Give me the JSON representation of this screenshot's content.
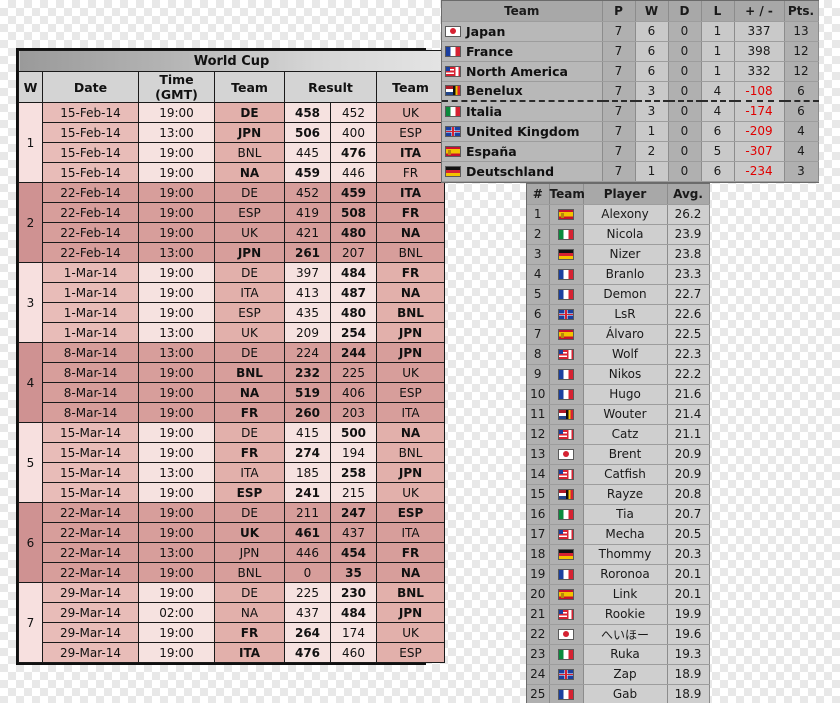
{
  "world_cup": {
    "title": "World Cup",
    "headers": [
      "W",
      "Date",
      "Time (GMT)",
      "Team",
      "Result",
      "Team"
    ],
    "weeks": [
      {
        "w": "1",
        "tint": "odd",
        "matches": [
          {
            "date": "15-Feb-14",
            "time": "19:00",
            "home": "DE",
            "hs": "458",
            "as": "452",
            "away": "UK",
            "winner": "home"
          },
          {
            "date": "15-Feb-14",
            "time": "13:00",
            "home": "JPN",
            "hs": "506",
            "as": "400",
            "away": "ESP",
            "winner": "home"
          },
          {
            "date": "15-Feb-14",
            "time": "19:00",
            "home": "BNL",
            "hs": "445",
            "as": "476",
            "away": "ITA",
            "winner": "away"
          },
          {
            "date": "15-Feb-14",
            "time": "19:00",
            "home": "NA",
            "hs": "459",
            "as": "446",
            "away": "FR",
            "winner": "home"
          }
        ]
      },
      {
        "w": "2",
        "tint": "even",
        "matches": [
          {
            "date": "22-Feb-14",
            "time": "19:00",
            "home": "DE",
            "hs": "452",
            "as": "459",
            "away": "ITA",
            "winner": "away"
          },
          {
            "date": "22-Feb-14",
            "time": "19:00",
            "home": "ESP",
            "hs": "419",
            "as": "508",
            "away": "FR",
            "winner": "away"
          },
          {
            "date": "22-Feb-14",
            "time": "19:00",
            "home": "UK",
            "hs": "421",
            "as": "480",
            "away": "NA",
            "winner": "away"
          },
          {
            "date": "22-Feb-14",
            "time": "13:00",
            "home": "JPN",
            "hs": "261",
            "as": "207",
            "away": "BNL",
            "winner": "home"
          }
        ]
      },
      {
        "w": "3",
        "tint": "odd",
        "matches": [
          {
            "date": "1-Mar-14",
            "time": "19:00",
            "home": "DE",
            "hs": "397",
            "as": "484",
            "away": "FR",
            "winner": "away"
          },
          {
            "date": "1-Mar-14",
            "time": "19:00",
            "home": "ITA",
            "hs": "413",
            "as": "487",
            "away": "NA",
            "winner": "away"
          },
          {
            "date": "1-Mar-14",
            "time": "19:00",
            "home": "ESP",
            "hs": "435",
            "as": "480",
            "away": "BNL",
            "winner": "away"
          },
          {
            "date": "1-Mar-14",
            "time": "13:00",
            "home": "UK",
            "hs": "209",
            "as": "254",
            "away": "JPN",
            "winner": "away"
          }
        ]
      },
      {
        "w": "4",
        "tint": "even",
        "matches": [
          {
            "date": "8-Mar-14",
            "time": "13:00",
            "home": "DE",
            "hs": "224",
            "as": "244",
            "away": "JPN",
            "winner": "away"
          },
          {
            "date": "8-Mar-14",
            "time": "19:00",
            "home": "BNL",
            "hs": "232",
            "as": "225",
            "away": "UK",
            "winner": "home"
          },
          {
            "date": "8-Mar-14",
            "time": "19:00",
            "home": "NA",
            "hs": "519",
            "as": "406",
            "away": "ESP",
            "winner": "home"
          },
          {
            "date": "8-Mar-14",
            "time": "19:00",
            "home": "FR",
            "hs": "260",
            "as": "203",
            "away": "ITA",
            "winner": "home"
          }
        ]
      },
      {
        "w": "5",
        "tint": "odd",
        "matches": [
          {
            "date": "15-Mar-14",
            "time": "19:00",
            "home": "DE",
            "hs": "415",
            "as": "500",
            "away": "NA",
            "winner": "away"
          },
          {
            "date": "15-Mar-14",
            "time": "19:00",
            "home": "FR",
            "hs": "274",
            "as": "194",
            "away": "BNL",
            "winner": "home"
          },
          {
            "date": "15-Mar-14",
            "time": "13:00",
            "home": "ITA",
            "hs": "185",
            "as": "258",
            "away": "JPN",
            "winner": "away"
          },
          {
            "date": "15-Mar-14",
            "time": "19:00",
            "home": "ESP",
            "hs": "241",
            "as": "215",
            "away": "UK",
            "winner": "home"
          }
        ]
      },
      {
        "w": "6",
        "tint": "even",
        "matches": [
          {
            "date": "22-Mar-14",
            "time": "19:00",
            "home": "DE",
            "hs": "211",
            "as": "247",
            "away": "ESP",
            "winner": "away"
          },
          {
            "date": "22-Mar-14",
            "time": "19:00",
            "home": "UK",
            "hs": "461",
            "as": "437",
            "away": "ITA",
            "winner": "home"
          },
          {
            "date": "22-Mar-14",
            "time": "13:00",
            "home": "JPN",
            "hs": "446",
            "as": "454",
            "away": "FR",
            "winner": "away"
          },
          {
            "date": "22-Mar-14",
            "time": "19:00",
            "home": "BNL",
            "hs": "0",
            "as": "35",
            "away": "NA",
            "winner": "away"
          }
        ]
      },
      {
        "w": "7",
        "tint": "odd",
        "matches": [
          {
            "date": "29-Mar-14",
            "time": "19:00",
            "home": "DE",
            "hs": "225",
            "as": "230",
            "away": "BNL",
            "winner": "away"
          },
          {
            "date": "29-Mar-14",
            "time": "02:00",
            "home": "NA",
            "hs": "437",
            "as": "484",
            "away": "JPN",
            "winner": "away"
          },
          {
            "date": "29-Mar-14",
            "time": "19:00",
            "home": "FR",
            "hs": "264",
            "as": "174",
            "away": "UK",
            "winner": "home"
          },
          {
            "date": "29-Mar-14",
            "time": "19:00",
            "home": "ITA",
            "hs": "476",
            "as": "460",
            "away": "ESP",
            "winner": "home"
          }
        ]
      }
    ]
  },
  "standings": {
    "headers": [
      "Team",
      "P",
      "W",
      "D",
      "L",
      "+ / -",
      "Pts."
    ],
    "rows": [
      {
        "flag": "jp",
        "team": "Japan",
        "p": "7",
        "w": "6",
        "d": "0",
        "l": "1",
        "diff": "337",
        "pts": "13",
        "neg": false
      },
      {
        "flag": "fr",
        "team": "France",
        "p": "7",
        "w": "6",
        "d": "0",
        "l": "1",
        "diff": "398",
        "pts": "12",
        "neg": false
      },
      {
        "flag": "na",
        "team": "North America",
        "p": "7",
        "w": "6",
        "d": "0",
        "l": "1",
        "diff": "332",
        "pts": "12",
        "neg": false
      },
      {
        "flag": "bnl",
        "team": "Benelux",
        "p": "7",
        "w": "3",
        "d": "0",
        "l": "4",
        "diff": "-108",
        "pts": "6",
        "neg": true
      },
      {
        "flag": "it",
        "team": "Italia",
        "p": "7",
        "w": "3",
        "d": "0",
        "l": "4",
        "diff": "-174",
        "pts": "6",
        "neg": true
      },
      {
        "flag": "uk",
        "team": "United Kingdom",
        "p": "7",
        "w": "1",
        "d": "0",
        "l": "6",
        "diff": "-209",
        "pts": "4",
        "neg": true
      },
      {
        "flag": "es",
        "team": "España",
        "p": "7",
        "w": "2",
        "d": "0",
        "l": "5",
        "diff": "-307",
        "pts": "4",
        "neg": true
      },
      {
        "flag": "de",
        "team": "Deutschland",
        "p": "7",
        "w": "1",
        "d": "0",
        "l": "6",
        "diff": "-234",
        "pts": "3",
        "neg": true
      }
    ],
    "cut_after_index": 3
  },
  "players": {
    "headers": [
      "#",
      "Team",
      "Player",
      "Avg."
    ],
    "rows": [
      {
        "rank": "1",
        "flag": "es",
        "player": "Alexony",
        "avg": "26.2"
      },
      {
        "rank": "2",
        "flag": "it",
        "player": "Nicola",
        "avg": "23.9"
      },
      {
        "rank": "3",
        "flag": "de",
        "player": "Nizer",
        "avg": "23.8"
      },
      {
        "rank": "4",
        "flag": "fr",
        "player": "Branlo",
        "avg": "23.3"
      },
      {
        "rank": "5",
        "flag": "fr",
        "player": "Demon",
        "avg": "22.7"
      },
      {
        "rank": "6",
        "flag": "uk",
        "player": "LsR",
        "avg": "22.6"
      },
      {
        "rank": "7",
        "flag": "es",
        "player": "Álvaro",
        "avg": "22.5"
      },
      {
        "rank": "8",
        "flag": "na",
        "player": "Wolf",
        "avg": "22.3"
      },
      {
        "rank": "9",
        "flag": "fr",
        "player": "Nikos",
        "avg": "22.2"
      },
      {
        "rank": "10",
        "flag": "fr",
        "player": "Hugo",
        "avg": "21.6"
      },
      {
        "rank": "11",
        "flag": "bnl",
        "player": "Wouter",
        "avg": "21.4"
      },
      {
        "rank": "12",
        "flag": "na",
        "player": "Catz",
        "avg": "21.1"
      },
      {
        "rank": "13",
        "flag": "jp",
        "player": "Brent",
        "avg": "20.9"
      },
      {
        "rank": "14",
        "flag": "na",
        "player": "Catfish",
        "avg": "20.9"
      },
      {
        "rank": "15",
        "flag": "bnl",
        "player": "Rayze",
        "avg": "20.8"
      },
      {
        "rank": "16",
        "flag": "it",
        "player": "Tia",
        "avg": "20.7"
      },
      {
        "rank": "17",
        "flag": "na",
        "player": "Mecha",
        "avg": "20.5"
      },
      {
        "rank": "18",
        "flag": "de",
        "player": "Thommy",
        "avg": "20.3"
      },
      {
        "rank": "19",
        "flag": "fr",
        "player": "Roronoa",
        "avg": "20.1"
      },
      {
        "rank": "20",
        "flag": "es",
        "player": "Link",
        "avg": "20.1"
      },
      {
        "rank": "21",
        "flag": "na",
        "player": "Rookie",
        "avg": "19.9"
      },
      {
        "rank": "22",
        "flag": "jp",
        "player": "へいほー",
        "avg": "19.6"
      },
      {
        "rank": "23",
        "flag": "it",
        "player": "Ruka",
        "avg": "19.3"
      },
      {
        "rank": "24",
        "flag": "uk",
        "player": "Zap",
        "avg": "18.9"
      },
      {
        "rank": "25",
        "flag": "fr",
        "player": "Gab",
        "avg": "18.9"
      }
    ]
  }
}
